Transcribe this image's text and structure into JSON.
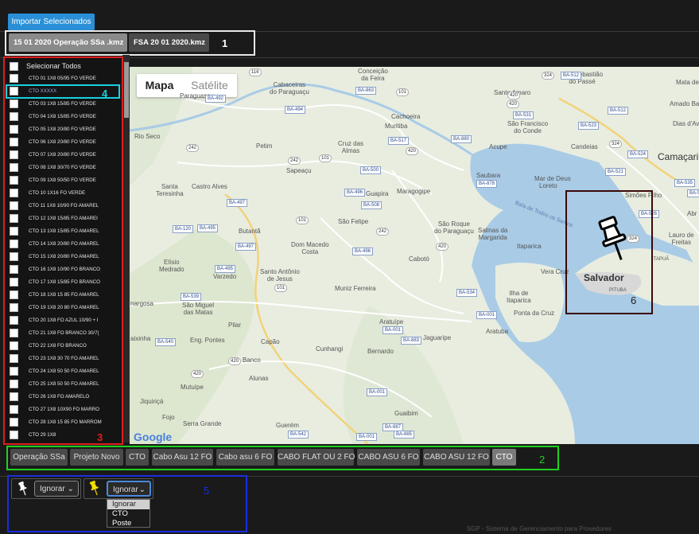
{
  "toolbar": {
    "import_label": "Importar Selecionados"
  },
  "file_tabs": [
    "15 01 2020 Operação SSa .kmz",
    "FSA 20 01 2020.kmz"
  ],
  "annotations": {
    "a1": "1",
    "a2": "2",
    "a3": "3",
    "a4": "4",
    "a5": "5",
    "a6": "6"
  },
  "list": {
    "select_all": "Selecionar Todos",
    "items": [
      "CTO 01 1X8 05/95 FO VERDE",
      "CTO XXXXX",
      "CTO 03 1X8 15/85 FO VERDE",
      "CTO 04 1X8 15/85 FO VERDE",
      "CTO 05 1X8 20/80 FO VERDE",
      "CTO 06 1X8 20/80 FO VERDE",
      "CTO 07 1X8 20/80 FO VERDE",
      "CTO 08 1X8 30/70 FO VERDE",
      "CTO 09 1X8 50/50 FO VERDE",
      "CTO 10 1X16 FO VERDE",
      "CTO 11 1X8 10/90 FO AMAREL",
      "CTO 12 1X8  15/85 FO AMAREI",
      "CTO 13 1X8 15/85 FO AMAREL",
      "CTO 14 1X8 20/80 FO AMAREL",
      "CTO 15 1X8 20/80 FO AMAREL",
      "CTO 16 1X8 10/90 FO BRANCO",
      "CTO 17 1X8 15/85 FO BRANCO",
      "CTO 18 1X8 15 85 FO AMAREL",
      "CTO 19 1X8 20 80 FO AMAREL",
      "CTO 20 1X8 FO AZUL 10/90 + I",
      "CTO 21 1X8 FO BRANCO 30/7(",
      "CTO 22 1X8 FO BRANCO",
      "CTO 23 1X8 30 70 FO AMAREL",
      "CTO 24 1X8 50 50 FO AMAREL",
      "CTO 25 1X8 50 50 FO AMAREL",
      "CTO 26 1X8 FO AMARELO",
      "CTO 27 1X8 10X90 FO MARRO",
      "CTO 28 1X8 15 85 FO MARROM",
      "CTO 29 1X8"
    ]
  },
  "map": {
    "type_map": "Mapa",
    "type_satellite": "Satélite",
    "google": "Google",
    "cities": {
      "conceicao": "Conceição\nda Feira",
      "cabaceiras": "Cabaceiras\ndo Paraguaçu",
      "santo_amaro": "Santo Amaro",
      "sao_sebastiao": "São Sebastião\ndo Passé",
      "paraguassu": "Paraguassu",
      "cachoeira": "Cachoeira",
      "muritiba": "Muritiba",
      "sao_francisco": "São Francisco\ndo Conde",
      "candeias": "Candeias",
      "camacari": "Camaçari",
      "rio_seco": "Rio Seco",
      "petim": "Petim",
      "cruz_das_almas": "Cruz das\nAlmas",
      "acupe": "Acupe",
      "sapeacu": "Sapeaçu",
      "saubara": "Saubara",
      "mar_grande_loreto": "Loreto",
      "santa_teresinha": "Santa\nTeresinha",
      "castro_alves": "Castro Alves",
      "guapira": "Guapira",
      "maragogipe": "Maragogipe",
      "sao_felipe": "São Felipe",
      "sao_roque": "São Roque\ndo Paraguaçu",
      "salinas": "Salinas da\nMargarida",
      "itaparica": "Itaparica",
      "butanta": "Butantã",
      "dom_macedo": "Dom Macedo\nCosta",
      "cabote": "Cabotó",
      "elisio_medrado": "Elísio\nMedrado",
      "varzedo": "Varzedo",
      "santo_antonio": "Santo Antônio\nde Jesus",
      "vera_cruz": "Vera Cruz",
      "salvador": "Salvador",
      "pituba": "PITUBA",
      "muniz_ferreira": "Muniz Ferreira",
      "ilha_de_itaparica": "Ilha de\nItaparica",
      "ponta_da_cruz": "Ponta da Cruz",
      "nargosa": "nargosa",
      "sao_miguel": "São Miguel\ndas Matas",
      "pilar": "Pilar",
      "aratuipe": "Aratuípe",
      "aratuba": "Aratuba",
      "jaguaripe": "Jaguaripe",
      "laixinha": "aixinha",
      "eng_pontes": "Eng. Pontes",
      "capao": "Capão",
      "cunhangi": "Cunhangi",
      "bernardo": "Bernardo",
      "banco": "Banco",
      "alunas": "Alunas",
      "mutuipe": "Mutuípe",
      "jiquirica": "Jiquiriçá",
      "guaibim": "Guaibim",
      "fojo": "Fojo",
      "serra_grande": "Serra Grande",
      "guerem": "Guerém",
      "mata_de": "Mata de",
      "amado_ba": "Amado Ba",
      "dias_d_avila": "Dias d'Avi",
      "simoes_filho": "Simões Filho",
      "lauro_de_freitas": "Lauro de\nFreitas",
      "itapua": "ITAPUÃ",
      "abr": "Abr",
      "mar_grande": "Mar de Deus",
      "baia": "Baía de Todos os Santos"
    }
  },
  "layer_tabs": [
    "Operação SSa",
    "Projeto Novo",
    "CTO",
    "Cabo Asu 12 FO",
    "Cabo asu 6 FO",
    "CABO FLAT OU 2 FO",
    "CABO ASU 6 FO",
    "CABO ASU 12 FO",
    "CTO"
  ],
  "bottom": {
    "select1_value": "Ignorar",
    "select2_value": "Ignorar",
    "options": [
      "Ignorar",
      "CTO",
      "Poste"
    ]
  },
  "footer": "SGP - Sistema de Gerenciamento para Provedores",
  "colors": {
    "accent": "#2a8fd6",
    "highlight_box_1": "#e8e8e8",
    "box_2": "#20d020",
    "box_3": "#e01e1e",
    "box_4": "#18d0e0",
    "box_5": "#1a2ee0",
    "box_6": "#3a0808"
  }
}
